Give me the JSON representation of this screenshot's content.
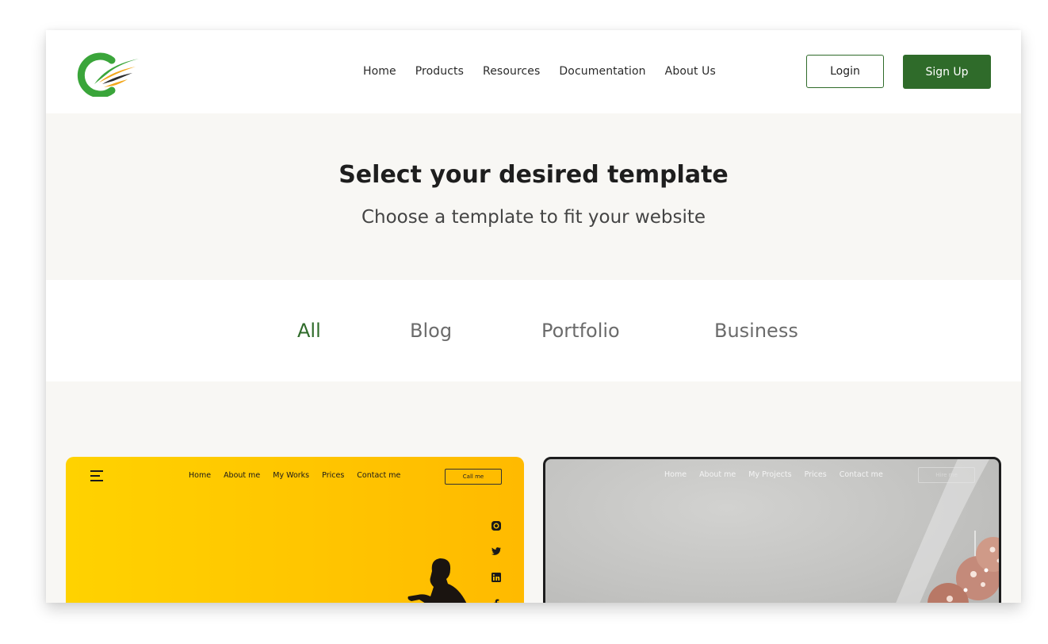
{
  "brand": {
    "accent": "#2f6b2a",
    "logo_colors": [
      "#3aa53a",
      "#f2a71b",
      "#2c2c2c"
    ]
  },
  "nav": {
    "items": [
      "Home",
      "Products",
      "Resources",
      "Documentation",
      "About Us"
    ]
  },
  "auth": {
    "login_label": "Login",
    "signup_label": "Sign Up"
  },
  "hero": {
    "title": "Select your desired template",
    "subtitle": "Choose a template to fit your website"
  },
  "filters": {
    "tabs": [
      "All",
      "Blog",
      "Portfolio",
      "Business"
    ],
    "active": "All"
  },
  "templates": [
    {
      "theme_color": "#ffc400",
      "nav": [
        "Home",
        "About me",
        "My Works",
        "Prices",
        "Contact me"
      ],
      "button_label": "Call me",
      "social_icons": [
        "instagram-icon",
        "twitter-icon",
        "linkedin-icon",
        "facebook-icon"
      ]
    },
    {
      "theme_color": "#c3c3c1",
      "nav": [
        "Home",
        "About me",
        "My Projects",
        "Prices",
        "Contact me"
      ],
      "button_label": "Hire me"
    }
  ]
}
